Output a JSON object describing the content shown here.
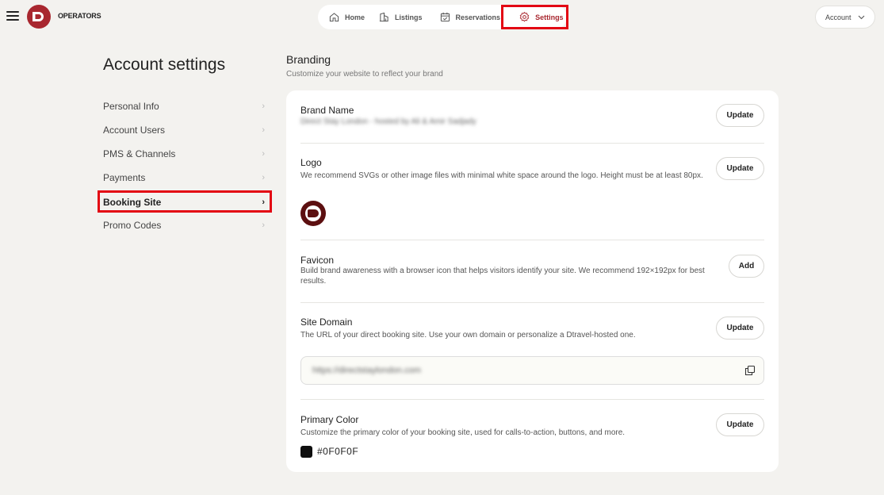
{
  "header": {
    "brand_text": "OPERATORS",
    "brand_letter": "D",
    "nav": [
      {
        "label": "Home",
        "icon": "home-icon"
      },
      {
        "label": "Listings",
        "icon": "building-icon"
      },
      {
        "label": "Reservations",
        "icon": "calendar-icon"
      },
      {
        "label": "Settings",
        "icon": "gear-icon",
        "active": true
      }
    ],
    "account_label": "Account"
  },
  "sidebar": {
    "title": "Account settings",
    "items": [
      {
        "label": "Personal Info"
      },
      {
        "label": "Account Users"
      },
      {
        "label": "PMS & Channels"
      },
      {
        "label": "Payments"
      },
      {
        "label": "Booking Site",
        "active": true
      },
      {
        "label": "Promo Codes"
      }
    ]
  },
  "main": {
    "title": "Branding",
    "subtitle": "Customize your website to reflect your brand",
    "brand_name": {
      "title": "Brand Name",
      "value": "Direct Stay London - hosted by Ali & Amir Sadjady",
      "button": "Update"
    },
    "logo": {
      "title": "Logo",
      "description": "We recommend SVGs or other image files with minimal white space around the logo. Height must be at least 80px.",
      "button": "Update"
    },
    "favicon": {
      "title": "Favicon",
      "description": "Build brand awareness with a browser icon that helps visitors identify your site. We recommend 192×192px for best results.",
      "button": "Add"
    },
    "site_domain": {
      "title": "Site Domain",
      "description": "The URL of your direct booking site. Use your own domain or personalize a Dtravel-hosted one.",
      "button": "Update",
      "url": "https://directstaylondon.com"
    },
    "primary_color": {
      "title": "Primary Color",
      "description": "Customize the primary color of your booking site, used for calls-to-action, buttons, and more.",
      "button": "Update",
      "value": "#0F0F0F",
      "swatch": "#0f0f0f"
    }
  },
  "colors": {
    "accent": "#a8272f",
    "highlight": "#e30613",
    "background": "#f3f2ef"
  }
}
